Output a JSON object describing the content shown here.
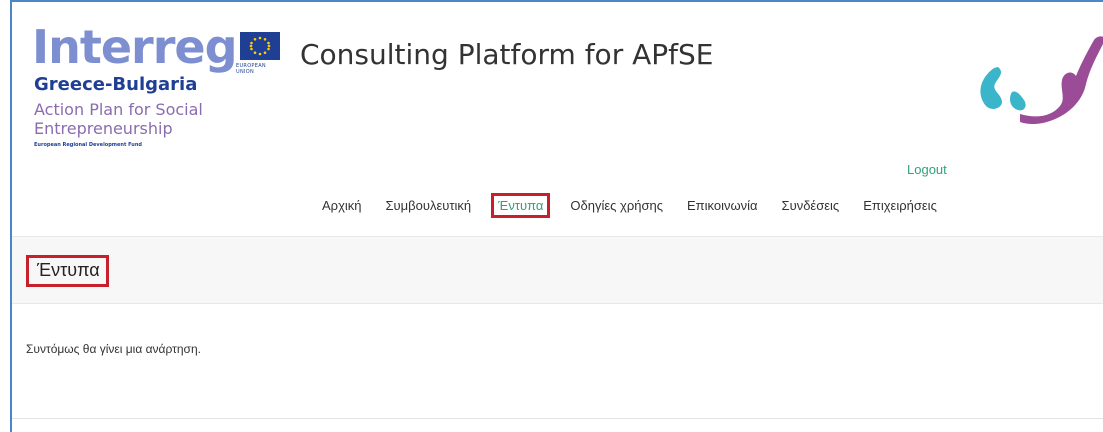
{
  "logo": {
    "word": "Interreg",
    "program": "Greece-Bulgaria",
    "subtitle": "Action Plan for Social Entrepreneurship",
    "fund": "European Regional Development Fund",
    "eu_caption": "EUROPEAN UNION"
  },
  "site": {
    "title": "Consulting Platform for APfSE"
  },
  "header": {
    "logout_label": "Logout"
  },
  "nav": {
    "items": [
      {
        "label": "Αρχική"
      },
      {
        "label": "Συμβουλευτική"
      },
      {
        "label": "Έντυπα",
        "active": true
      },
      {
        "label": "Οδηγίες χρήσης"
      },
      {
        "label": "Επικοινωνία"
      },
      {
        "label": "Συνδέσεις"
      },
      {
        "label": "Επιχειρήσεις"
      }
    ]
  },
  "page": {
    "title": "Έντυπα",
    "message": "Συντόμως θα γίνει μια ανάρτηση."
  },
  "colors": {
    "accent_green": "#2fa27a",
    "highlight_red": "#c8202a",
    "logo_blue": "#1f3f95",
    "logo_purple": "#8a6cb0",
    "brand_teal": "#3bb5c9",
    "brand_purple": "#9a4d96"
  }
}
